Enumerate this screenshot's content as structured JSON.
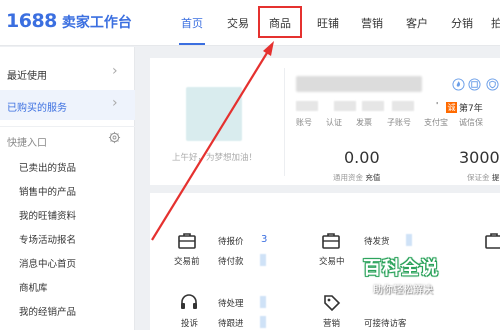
{
  "logo": {
    "number": "1688",
    "text": "卖家工作台"
  },
  "nav": {
    "items": [
      {
        "label": "首页",
        "active": true
      },
      {
        "label": "交易"
      },
      {
        "label": "商品"
      },
      {
        "label": "旺铺"
      },
      {
        "label": "营销"
      },
      {
        "label": "客户"
      },
      {
        "label": "分销"
      },
      {
        "label": "拍"
      }
    ]
  },
  "sidebar": {
    "recent": "最近使用",
    "purchased": "已购买的服务",
    "quick_title": "快捷入口",
    "quick_items": [
      "已卖出的货品",
      "销售中的产品",
      "我的旺铺资料",
      "专场活动报名",
      "消息中心首页",
      "商机库",
      "我的经销产品"
    ]
  },
  "account": {
    "greeting": "上午好，为梦想加油！",
    "cheng_badge": "诚",
    "years": "第7年",
    "info_labels": [
      "账号",
      "认证",
      "发票",
      "子账号",
      "支付宝",
      "诚信保"
    ],
    "funds": {
      "value": "0.00",
      "label": "通用资金",
      "link": "充值"
    },
    "deposit": {
      "value": "3000",
      "label": "保证金",
      "link": "提"
    }
  },
  "services": {
    "rows": [
      {
        "icon": "briefcase-icon",
        "label": "交易前",
        "stats": [
          {
            "label": "待报价",
            "value": "3"
          },
          {
            "label": "待付款",
            "value": ""
          }
        ]
      },
      {
        "icon": "briefcase-icon",
        "label": "交易中",
        "stats": [
          {
            "label": "待发货",
            "value": ""
          }
        ]
      },
      {
        "icon": "headset-icon",
        "label": "投诉",
        "stats": [
          {
            "label": "待处理",
            "value": ""
          },
          {
            "label": "待跟进",
            "value": ""
          }
        ]
      },
      {
        "icon": "tag-icon",
        "label": "营销",
        "stats": [
          {
            "label": "可接待访客",
            "value": ""
          }
        ]
      }
    ]
  },
  "watermark": {
    "title": "百科全说",
    "subtitle": "助你轻松解决"
  },
  "colors": {
    "accent": "#3b6fe0",
    "highlight": "#e5312f",
    "brand_orange": "#ff6a00"
  }
}
